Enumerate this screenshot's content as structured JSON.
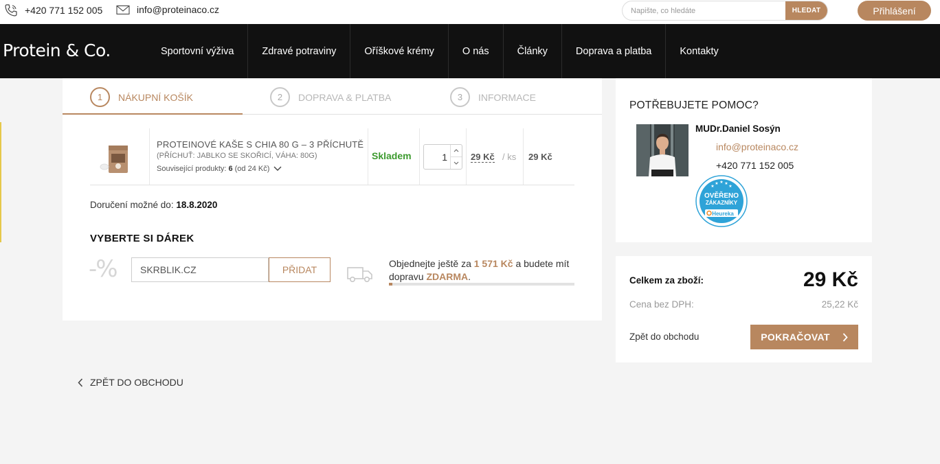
{
  "topbar": {
    "phone": "+420 771 152 005",
    "email": "info@proteinaco.cz",
    "search_placeholder": "Napište, co hledáte",
    "search_button": "HLEDAT",
    "login_button": "Přihlášení"
  },
  "nav": {
    "logo": "Protein & Co.",
    "items": [
      {
        "label": "Sportovní výživa"
      },
      {
        "label": "Zdravé potraviny"
      },
      {
        "label": "Oříškové krémy"
      },
      {
        "label": "O nás"
      },
      {
        "label": "Články"
      },
      {
        "label": "Doprava a platba"
      },
      {
        "label": "Kontakty"
      }
    ]
  },
  "steps": [
    {
      "num": "1",
      "label": "NÁKUPNÍ KOŠÍK"
    },
    {
      "num": "2",
      "label": "DOPRAVA & PLATBA"
    },
    {
      "num": "3",
      "label": "INFORMACE"
    }
  ],
  "cart": {
    "item": {
      "name": "PROTEINOVÉ KAŠE S CHIA 80 G – 3 PŘÍCHUTĚ",
      "variant": "(PŘÍCHUŤ: JABLKO SE SKOŘICÍ, VÁHA: 80G)",
      "related_label": "Související produkty:",
      "related_count": "6",
      "related_from": "(od 24 Kč)",
      "stock": "Skladem",
      "quantity": "1",
      "unit_price": "29 Kč",
      "per_unit": "/ ks",
      "total": "29 Kč"
    },
    "delivery_label": "Doručení možné do:",
    "delivery_date": "18.8.2020",
    "gift_title": "VYBERTE SI DÁREK",
    "percent_symbol": "-%",
    "coupon_value": "SKRBLIK.CZ",
    "coupon_button": "PŘIDAT",
    "shipping_text_1": "Objednejte ještě za",
    "shipping_amount": "1 571 Kč",
    "shipping_text_2": "a budete mít dopravu",
    "shipping_free": "ZDARMA",
    "shipping_text_3": ".",
    "shipping_progress": 0.02
  },
  "help": {
    "title": "POTŘEBUJETE POMOC?",
    "name": "MUDr.Daniel Sosýn",
    "email": "info@proteinaco.cz",
    "phone": "+420 771 152 005",
    "badge_line1": "OVĚŘENO",
    "badge_line2": "ZÁKAZNÍKY",
    "badge_brand": "Heureka"
  },
  "summary": {
    "total_label": "Celkem za zboží:",
    "total_value": "29 Kč",
    "vat_label": "Cena bez DPH:",
    "vat_value": "25,22 Kč",
    "back_label": "Zpět do obchodu",
    "continue_button": "POKRAČOVAT"
  },
  "back_link": "ZPĚT DO OBCHODU",
  "colors": {
    "accent": "#b8875f",
    "stock_green": "#3c9a2e",
    "nav_bg": "#111111",
    "page_bg": "#f4f4f4"
  }
}
